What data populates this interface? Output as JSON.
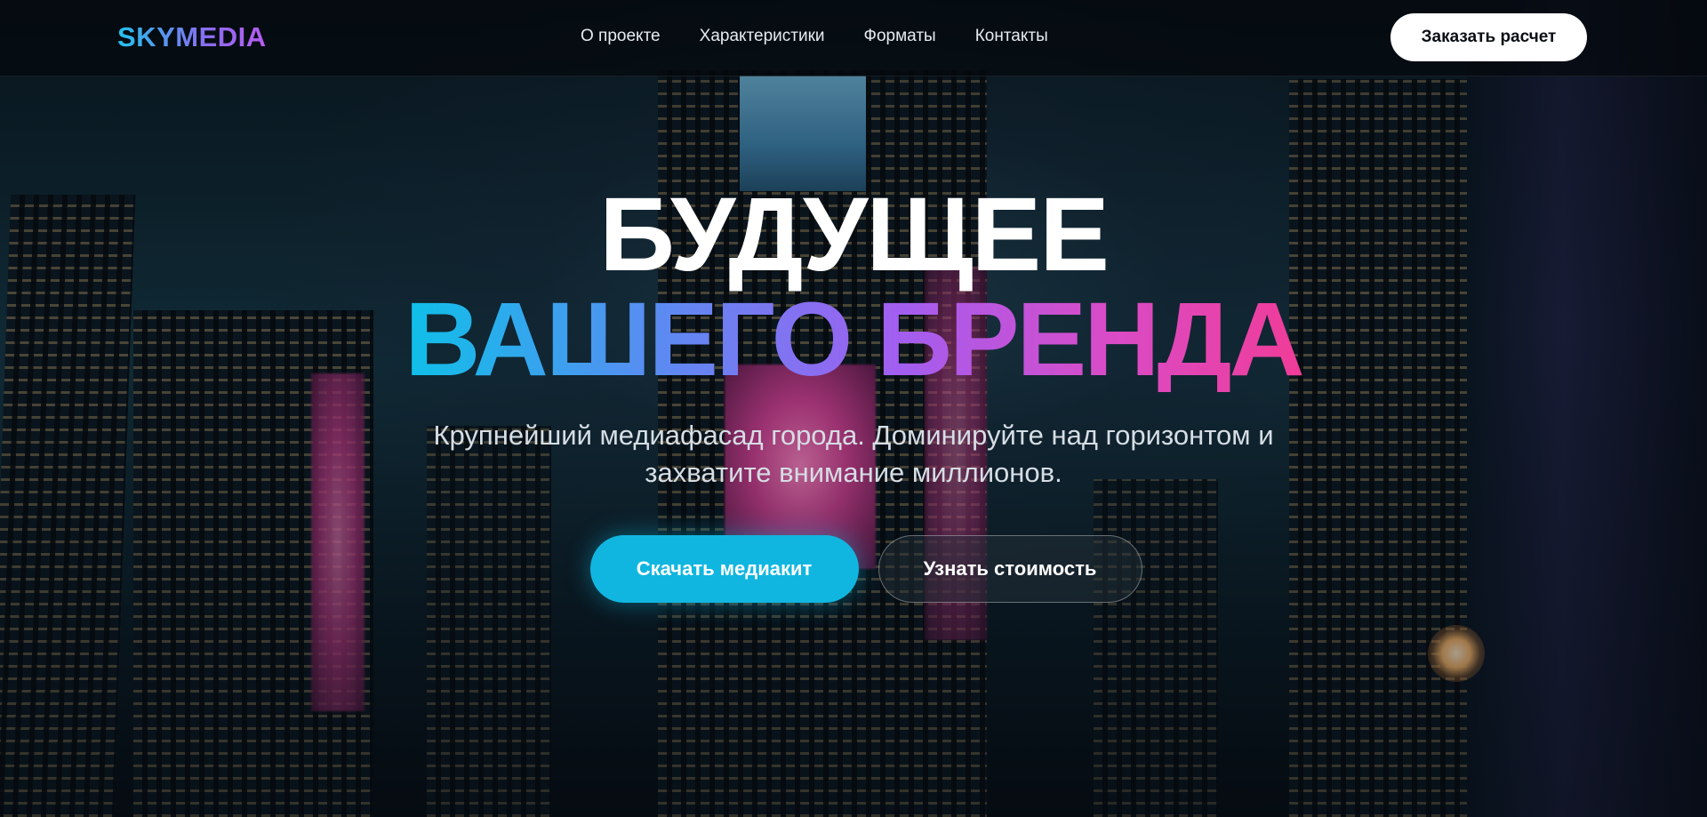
{
  "header": {
    "logo": "SKYMEDIA",
    "nav": [
      {
        "label": "О проекте"
      },
      {
        "label": "Характеристики"
      },
      {
        "label": "Форматы"
      },
      {
        "label": "Контакты"
      }
    ],
    "cta_label": "Заказать расчет"
  },
  "hero": {
    "title_line1": "БУДУЩЕЕ",
    "title_line2": "ВАШЕГО БРЕНДА",
    "subtitle": "Крупнейший медиафасад города. Доминируйте над горизонтом и захватите внимание миллионов.",
    "primary_button": "Скачать медиакит",
    "secondary_button": "Узнать стоимость"
  },
  "colors": {
    "accent_cyan": "#10b6e0",
    "accent_purple": "#a25ef0",
    "accent_pink": "#f03c98",
    "header_bg": "#04080c"
  }
}
